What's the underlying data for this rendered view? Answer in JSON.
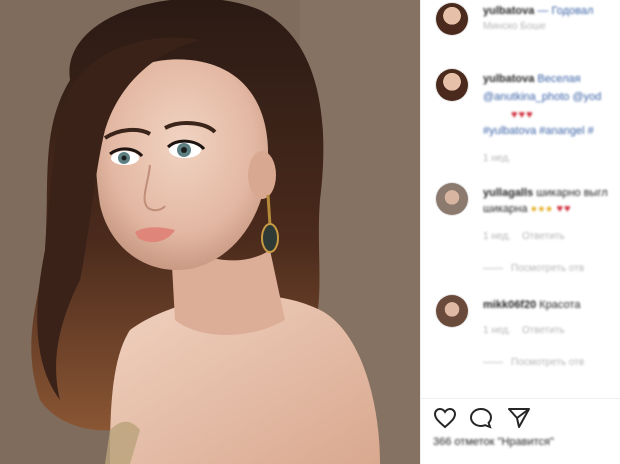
{
  "post": {
    "caption": {
      "username": "yulbatova",
      "text": "— Годовал",
      "subline": "Минско Боше"
    },
    "comments": [
      {
        "username": "yulbatova",
        "line1": "Веселая",
        "line2": "@anutkina_photo @yod",
        "line3": "#yulbatova #anangel #",
        "time": "1 нед."
      },
      {
        "username": "yullagalls",
        "line1": "шикарно выгл",
        "line2": "шикарна",
        "time": "1 нед.",
        "reply": "Ответить",
        "view_replies": "Посмотреть отв"
      },
      {
        "username": "mikk06f20",
        "line1": "Красота",
        "time": "1 нед.",
        "reply": "Ответить",
        "view_replies": "Посмотреть отв"
      }
    ],
    "likes": "366 отметок \"Нравится\""
  },
  "icons": {
    "like": "heart-icon",
    "comment": "comment-icon",
    "share": "share-icon"
  },
  "colors": {
    "link": "#3a62a6",
    "muted": "#b5b5b5",
    "background": "#ffffff"
  }
}
